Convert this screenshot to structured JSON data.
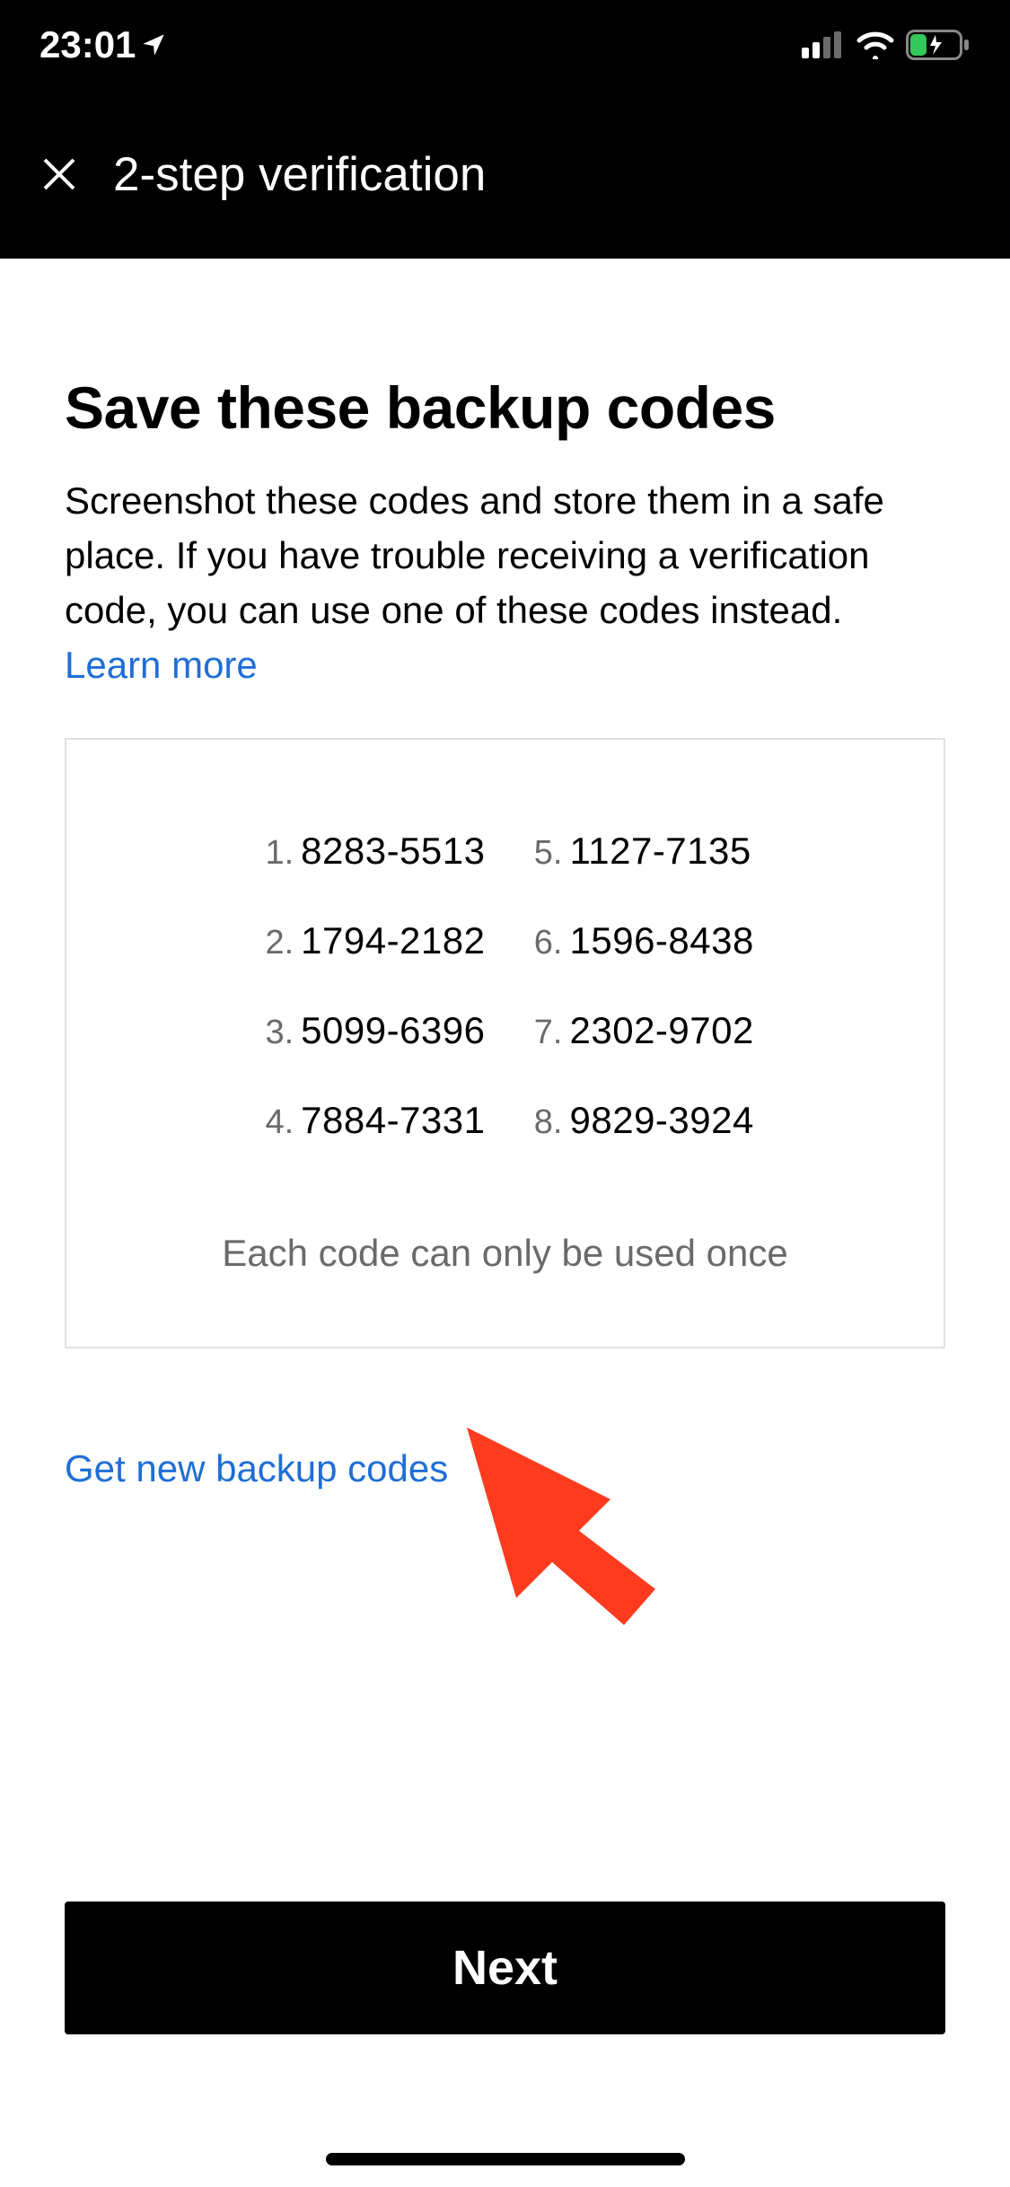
{
  "status": {
    "time": "23:01"
  },
  "nav": {
    "title": "2-step verification"
  },
  "page": {
    "headline": "Save these backup codes",
    "description": "Screenshot these codes and store them in a safe place. If you have trouble receiving a verification code, you can use one of these codes instead.",
    "learn_more": "Learn more"
  },
  "codes": {
    "left": [
      {
        "n": "1.",
        "v": "8283-5513"
      },
      {
        "n": "2.",
        "v": "1794-2182"
      },
      {
        "n": "3.",
        "v": "5099-6396"
      },
      {
        "n": "4.",
        "v": "7884-7331"
      }
    ],
    "right": [
      {
        "n": "5.",
        "v": "1127-7135"
      },
      {
        "n": "6.",
        "v": "1596-8438"
      },
      {
        "n": "7.",
        "v": "2302-9702"
      },
      {
        "n": "8.",
        "v": "9829-3924"
      }
    ],
    "note": "Each code can only be used once"
  },
  "links": {
    "get_new": "Get new backup codes"
  },
  "buttons": {
    "next": "Next"
  }
}
